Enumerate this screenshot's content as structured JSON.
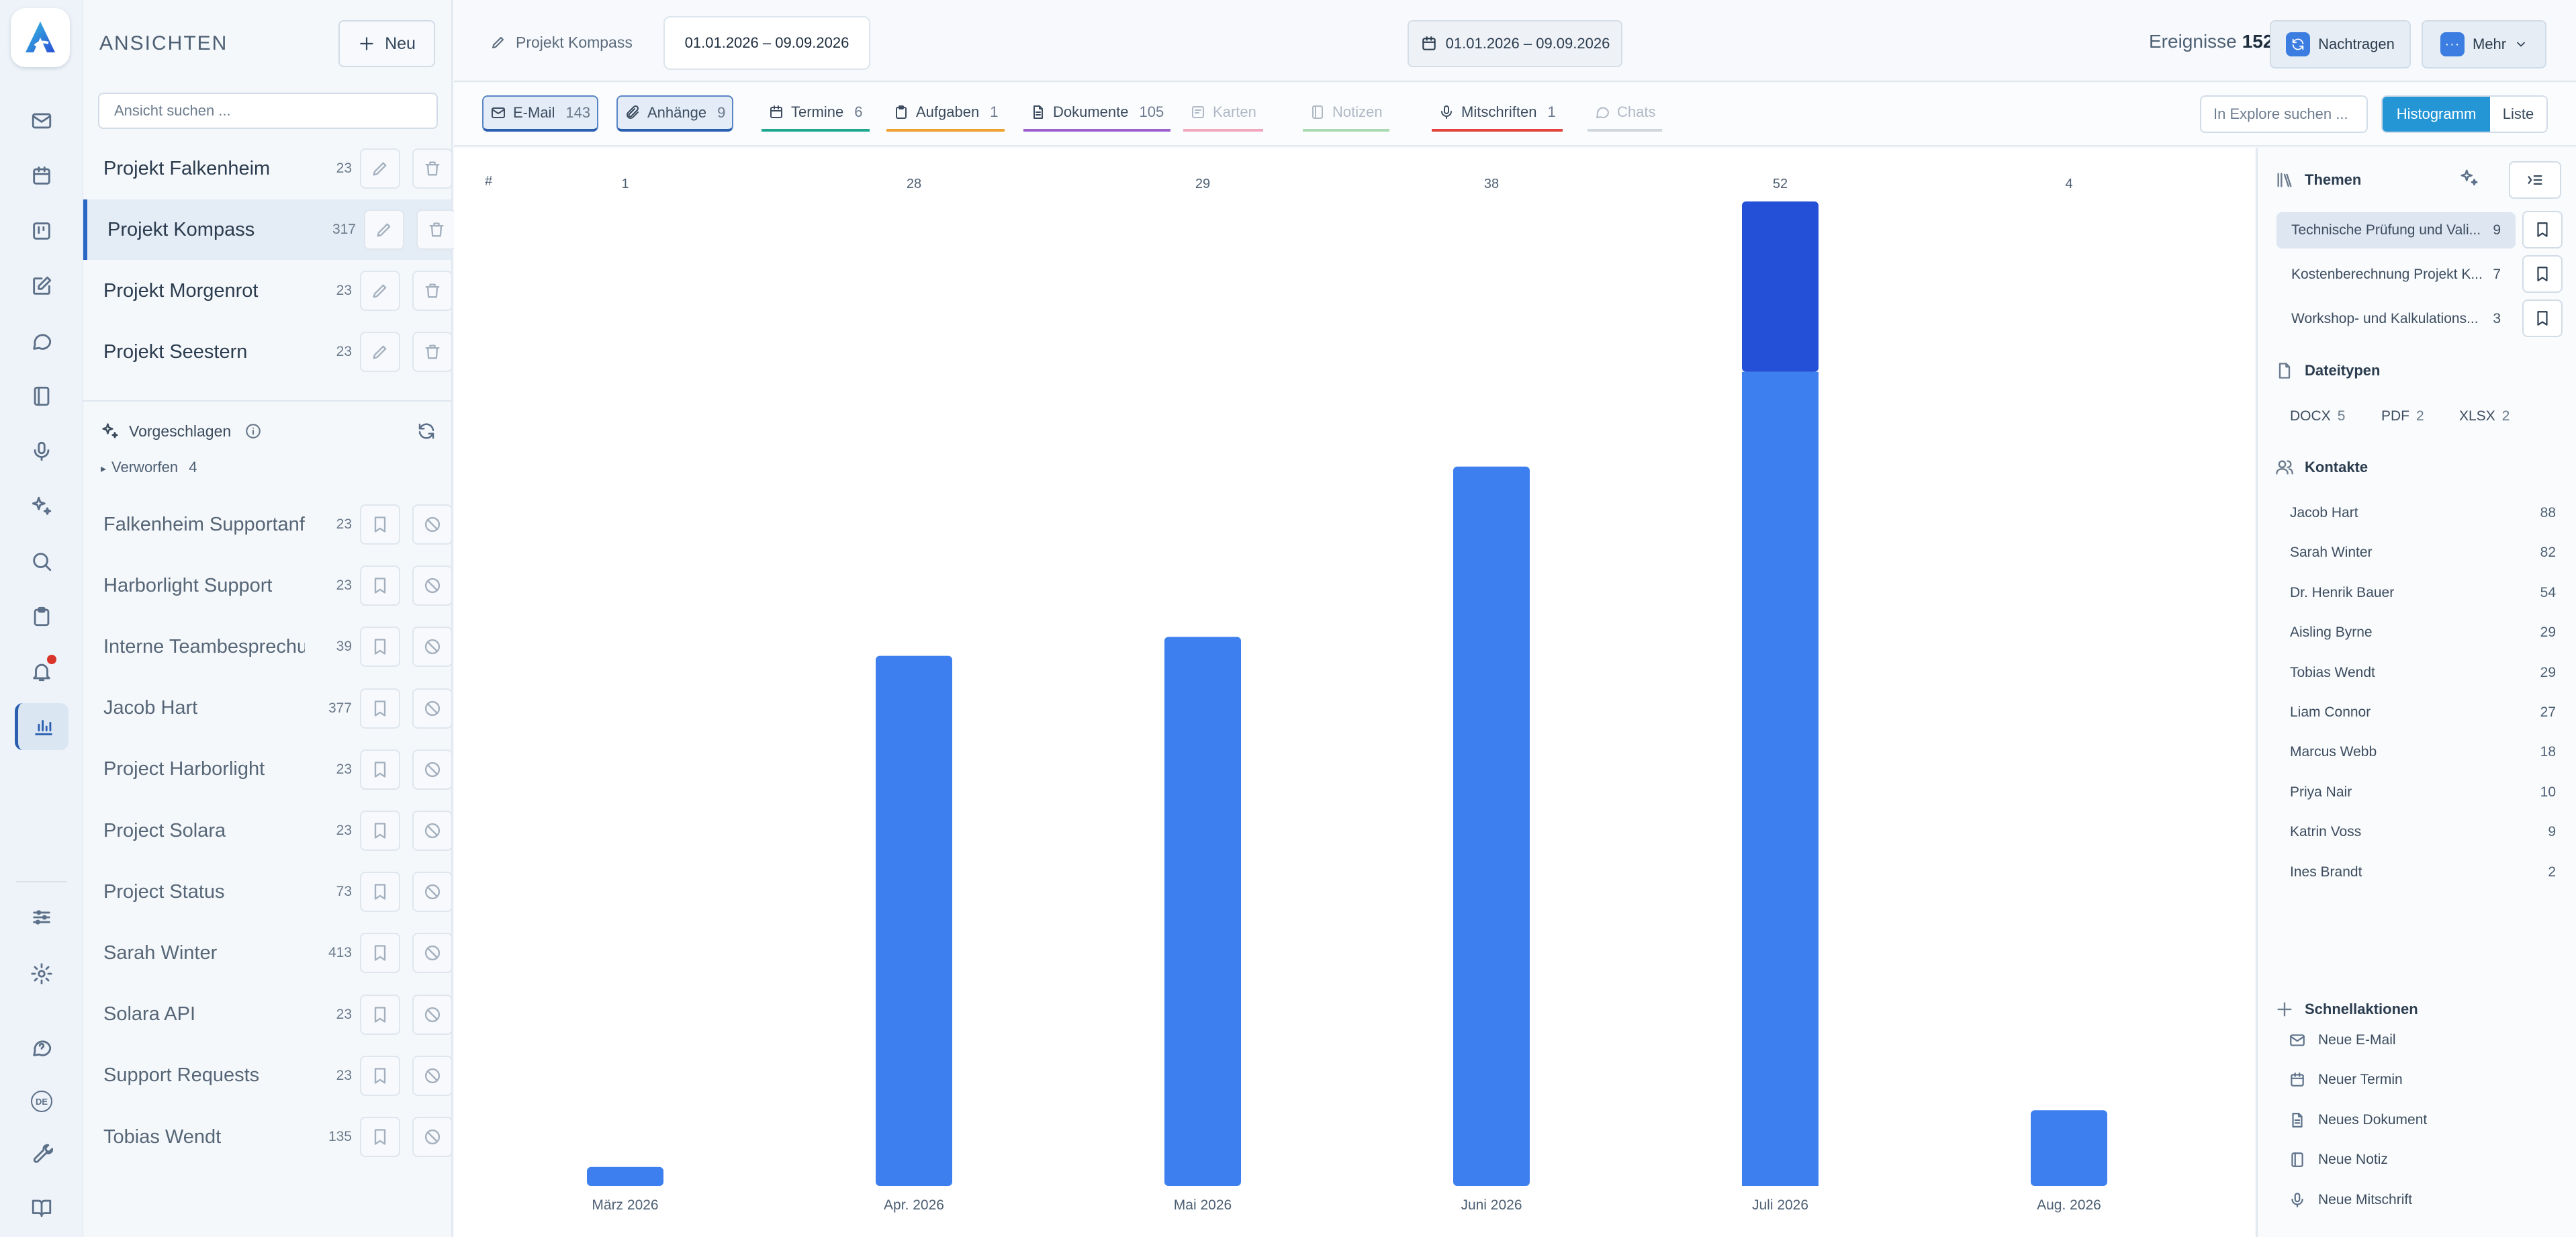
{
  "rail": {
    "items": [
      {
        "icon": "mail-icon"
      },
      {
        "icon": "calendar-icon"
      },
      {
        "icon": "kanban-icon"
      },
      {
        "icon": "edit-icon"
      },
      {
        "icon": "chat-icon"
      },
      {
        "icon": "notebook-icon"
      },
      {
        "icon": "microphone-icon"
      },
      {
        "icon": "sparkles-icon"
      },
      {
        "icon": "search-icon"
      },
      {
        "icon": "clipboard-icon"
      },
      {
        "icon": "bell-icon"
      },
      {
        "icon": "chart-icon"
      }
    ],
    "bottom_items": [
      {
        "icon": "sliders-icon"
      },
      {
        "icon": "settings-icon"
      },
      {
        "icon": "help-chat-icon"
      },
      {
        "icon": "language-icon",
        "label": "DE"
      },
      {
        "icon": "tools-icon"
      },
      {
        "icon": "book-icon"
      }
    ]
  },
  "views": {
    "title": "ANSICHTEN",
    "new_label": "Neu",
    "search_placeholder": "Ansicht suchen ...",
    "items": [
      {
        "name": "Projekt Falkenheim",
        "count": "23"
      },
      {
        "name": "Projekt Kompass",
        "count": "317"
      },
      {
        "name": "Projekt Morgenrot",
        "count": "23"
      },
      {
        "name": "Projekt Seestern",
        "count": "23"
      }
    ],
    "suggested_title": "Vorgeschlagen",
    "discarded_label": "Verworfen",
    "discarded_count": "4",
    "suggested": [
      {
        "name": "Falkenheim Supportanf...",
        "count": "23"
      },
      {
        "name": "Harborlight Support",
        "count": "23"
      },
      {
        "name": "Interne Teambesprechu...",
        "count": "39"
      },
      {
        "name": "Jacob Hart",
        "count": "377"
      },
      {
        "name": "Project Harborlight",
        "count": "23"
      },
      {
        "name": "Project Solara",
        "count": "23"
      },
      {
        "name": "Project Status",
        "count": "73"
      },
      {
        "name": "Sarah Winter",
        "count": "413"
      },
      {
        "name": "Solara API",
        "count": "23"
      },
      {
        "name": "Support Requests",
        "count": "23"
      },
      {
        "name": "Tobias Wendt",
        "count": "135"
      }
    ]
  },
  "topbar": {
    "tab_project": "Projekt Kompass",
    "tab_date": "01.01.2026 – 09.09.2026",
    "date_range": "01.01.2026 – 09.09.2026",
    "events_label": "Ereignisse",
    "events_count": "152",
    "sync_label": "Nachtragen",
    "more_label": "Mehr"
  },
  "filters": [
    {
      "label": "E-Mail",
      "count": "143",
      "color": "#2a5fb0",
      "state": "active",
      "icon": "mail-icon"
    },
    {
      "label": "Anhänge",
      "count": "9",
      "color": "#2a5fb0",
      "state": "active",
      "icon": "paperclip-icon"
    },
    {
      "label": "Termine",
      "count": "6",
      "color": "#1fa88f",
      "state": "normal",
      "icon": "calendar-icon"
    },
    {
      "label": "Aufgaben",
      "count": "1",
      "color": "#f0a030",
      "state": "normal",
      "icon": "clipboard-icon"
    },
    {
      "label": "Dokumente",
      "count": "105",
      "color": "#9b5fd0",
      "state": "normal",
      "icon": "document-icon"
    },
    {
      "label": "Karten",
      "count": "",
      "color": "#f2a7bf",
      "state": "disabled",
      "icon": "card-icon"
    },
    {
      "label": "Notizen",
      "count": "",
      "color": "#a8dbb0",
      "state": "disabled",
      "icon": "note-icon"
    },
    {
      "label": "Mitschriften",
      "count": "1",
      "color": "#e0443c",
      "state": "normal",
      "icon": "microphone-icon"
    },
    {
      "label": "Chats",
      "count": "",
      "color": "#cfd6de",
      "state": "disabled",
      "icon": "chat-icon"
    }
  ],
  "explore_placeholder": "In Explore suchen ...",
  "view_mode": {
    "histogram": "Histogramm",
    "list": "Liste"
  },
  "chart_data": {
    "type": "bar",
    "stacked": true,
    "corner_label": "#",
    "categories": [
      "März 2026",
      "Apr. 2026",
      "Mai 2026",
      "Juni 2026",
      "Juli 2026",
      "Aug. 2026"
    ],
    "totals": [
      1,
      28,
      29,
      38,
      52,
      4
    ],
    "series": [
      {
        "values": [
          1,
          28,
          29,
          38,
          43,
          4
        ],
        "color": "#3d7fef"
      },
      {
        "values": [
          0,
          0,
          0,
          0,
          9,
          0
        ],
        "color": "#2350d6"
      }
    ],
    "ylim": [
      0,
      52
    ],
    "grid": false
  },
  "right_panel": {
    "themes_title": "Themen",
    "themes": [
      {
        "name": "Technische Prüfung und Vali...",
        "count": "9",
        "selected": true
      },
      {
        "name": "Kostenberechnung Projekt K...",
        "count": "7",
        "selected": false
      },
      {
        "name": "Workshop- und Kalkulations...",
        "count": "3",
        "selected": false
      }
    ],
    "filetypes_title": "Dateitypen",
    "filetypes": [
      {
        "name": "DOCX",
        "count": "5"
      },
      {
        "name": "PDF",
        "count": "2"
      },
      {
        "name": "XLSX",
        "count": "2"
      }
    ],
    "contacts_title": "Kontakte",
    "contacts": [
      {
        "name": "Jacob Hart",
        "count": "88"
      },
      {
        "name": "Sarah Winter",
        "count": "82"
      },
      {
        "name": "Dr. Henrik Bauer",
        "count": "54"
      },
      {
        "name": "Aisling Byrne",
        "count": "29"
      },
      {
        "name": "Tobias Wendt",
        "count": "29"
      },
      {
        "name": "Liam Connor",
        "count": "27"
      },
      {
        "name": "Marcus Webb",
        "count": "18"
      },
      {
        "name": "Priya Nair",
        "count": "10"
      },
      {
        "name": "Katrin Voss",
        "count": "9"
      },
      {
        "name": "Ines Brandt",
        "count": "2"
      }
    ],
    "quick_title": "Schnellaktionen",
    "quick_actions": [
      {
        "label": "Neue E-Mail",
        "icon": "mail-icon"
      },
      {
        "label": "Neuer Termin",
        "icon": "calendar-icon"
      },
      {
        "label": "Neues Dokument",
        "icon": "document-icon"
      },
      {
        "label": "Neue Notiz",
        "icon": "note-icon"
      },
      {
        "label": "Neue Mitschrift",
        "icon": "microphone-icon"
      }
    ]
  }
}
